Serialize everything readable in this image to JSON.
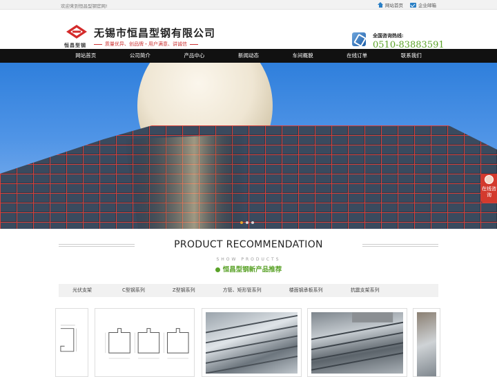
{
  "topbar": {
    "welcome": "欢迎来到恒昌型钢官网!",
    "links": [
      {
        "label": "网站首页",
        "icon": "home-icon"
      },
      {
        "label": "企业邮箱",
        "icon": "mail-icon"
      }
    ]
  },
  "header": {
    "logo_caption": "恒昌型钢",
    "company_name": "无锡市恒昌型钢有限公司",
    "slogan": "质量优异、创品牌・用户满意、讲诚信",
    "hotline_label": "全国咨询热线:",
    "hotline_number": "0510-83883591",
    "brand_color": "#c33",
    "accent_green": "#5aa228"
  },
  "nav": {
    "items": [
      "网站首页",
      "公司简介",
      "产品中心",
      "新闻动态",
      "车间概貌",
      "在线订单",
      "联系我们"
    ]
  },
  "banner": {
    "slide_count": 3,
    "active_slide": 1,
    "side_consult": "在线咨询"
  },
  "products": {
    "title": "PRODUCT RECOMMENDATION",
    "show_label": "SHOW PRODUCTS",
    "subtitle": "恒昌型钢新产品推荐",
    "tabs": [
      "光伏支架",
      "C型钢系列",
      "Z型钢系列",
      "方管、矩形管系列",
      "楼面钢承板系列",
      "抗震支架系列"
    ]
  }
}
